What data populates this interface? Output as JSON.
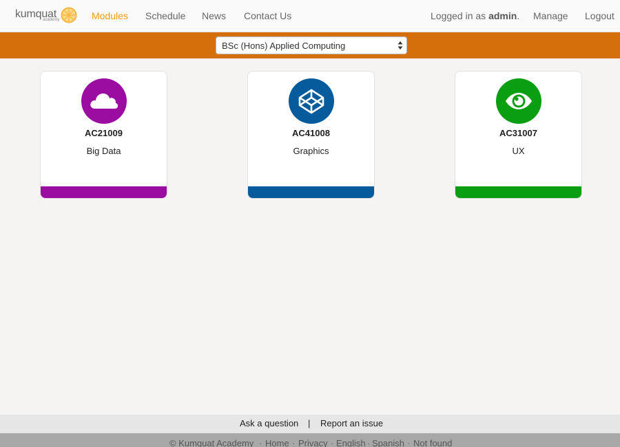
{
  "brand": {
    "logo_text": "kumquat",
    "logo_subtext": "academy"
  },
  "nav": {
    "items": [
      {
        "label": "Modules",
        "active": true
      },
      {
        "label": "Schedule",
        "active": false
      },
      {
        "label": "News",
        "active": false
      },
      {
        "label": "Contact Us",
        "active": false
      }
    ],
    "logged_in_prefix": "Logged in as ",
    "logged_in_user": "admin",
    "logged_in_suffix": ".",
    "manage_label": "Manage",
    "logout_label": "Logout",
    "active_color": "#f39c12"
  },
  "course_select": {
    "selected": "BSc (Hons) Applied Computing"
  },
  "modules": [
    {
      "code": "AC21009",
      "name": "Big Data",
      "color": "#9b0da1",
      "icon": "cloud-icon"
    },
    {
      "code": "AC41008",
      "name": "Graphics",
      "color": "#065b9c",
      "icon": "codepen-cube-icon"
    },
    {
      "code": "AC31007",
      "name": "UX",
      "color": "#0a9e12",
      "icon": "eye-icon"
    }
  ],
  "footer": {
    "ask_label": "Ask a question",
    "separator": "|",
    "report_label": "Report an issue",
    "copyright": "© Kumquat Academy",
    "links": [
      "Home",
      "Privacy",
      "English",
      "Spanish",
      "Not found"
    ]
  },
  "colors": {
    "band": "#d46f0a",
    "page_bg": "#f5f4f2"
  }
}
